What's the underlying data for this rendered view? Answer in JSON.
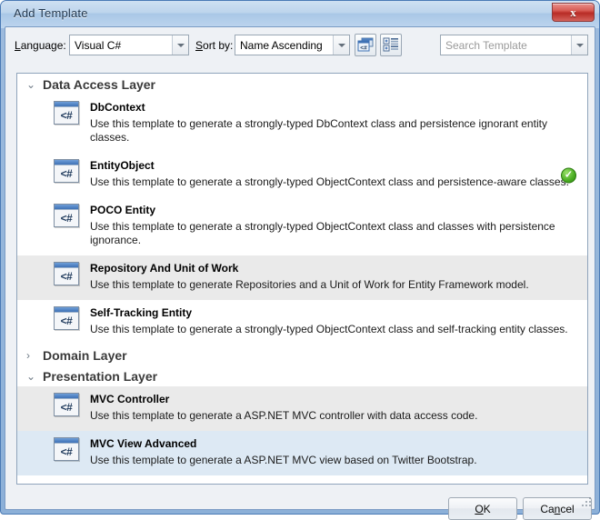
{
  "window": {
    "title": "Add Template",
    "close_label": "✕"
  },
  "toolbar": {
    "language_label": "Language:",
    "language_label_accel": "L",
    "language_value": "Visual C#",
    "sort_label": "Sort by:",
    "sort_label_accel": "S",
    "sort_value": "Name Ascending",
    "preview_button_name": "template-preview-toggle",
    "details_button_name": "details-view-toggle",
    "search_placeholder": "Search Template",
    "search_value": ""
  },
  "groups": [
    {
      "title": "Data Access Layer",
      "expanded": true,
      "chevron": "⌄",
      "items": [
        {
          "icon": "<#",
          "name": "DbContext",
          "desc": "Use this template to generate a strongly-typed DbContext class and persistence ignorant entity classes.",
          "state": "normal",
          "checked": false
        },
        {
          "icon": "<#",
          "name": "EntityObject",
          "desc": "Use this template to generate a strongly-typed ObjectContext class and persistence-aware classes.",
          "state": "normal",
          "checked": true
        },
        {
          "icon": "<#",
          "name": "POCO Entity",
          "desc": "Use this template to generate a strongly-typed ObjectContext class and classes with persistence ignorance.",
          "state": "normal",
          "checked": false
        },
        {
          "icon": "<#",
          "name": "Repository And Unit of Work",
          "desc": "Use this template to generate Repositories and a Unit of Work for Entity Framework model.",
          "state": "hover",
          "checked": false
        },
        {
          "icon": "<#",
          "name": "Self-Tracking Entity",
          "desc": "Use this template to generate a strongly-typed ObjectContext class and self-tracking entity classes.",
          "state": "normal",
          "checked": false
        }
      ]
    },
    {
      "title": "Domain Layer",
      "expanded": false,
      "chevron": "›",
      "items": []
    },
    {
      "title": "Presentation Layer",
      "expanded": true,
      "chevron": "⌄",
      "items": [
        {
          "icon": "<#",
          "name": "MVC Controller",
          "desc": "Use this template to generate a ASP.NET MVC controller with data access code.",
          "state": "hover",
          "checked": false
        },
        {
          "icon": "<#",
          "name": "MVC View Advanced",
          "desc": "Use this template to generate a ASP.NET MVC view based on Twitter Bootstrap.",
          "state": "selected",
          "checked": false
        }
      ]
    }
  ],
  "footer": {
    "ok_label": "OK",
    "ok_accel": "O",
    "cancel_label": "Cancel",
    "cancel_accel": "n"
  },
  "colors": {
    "title_bar": "#bcd4ec",
    "close_red": "#b82b25",
    "selected_row": "#dde9f4",
    "hover_row": "#eaeaea",
    "check_green": "#4aad22",
    "icon_blue": "#3f72b5"
  }
}
